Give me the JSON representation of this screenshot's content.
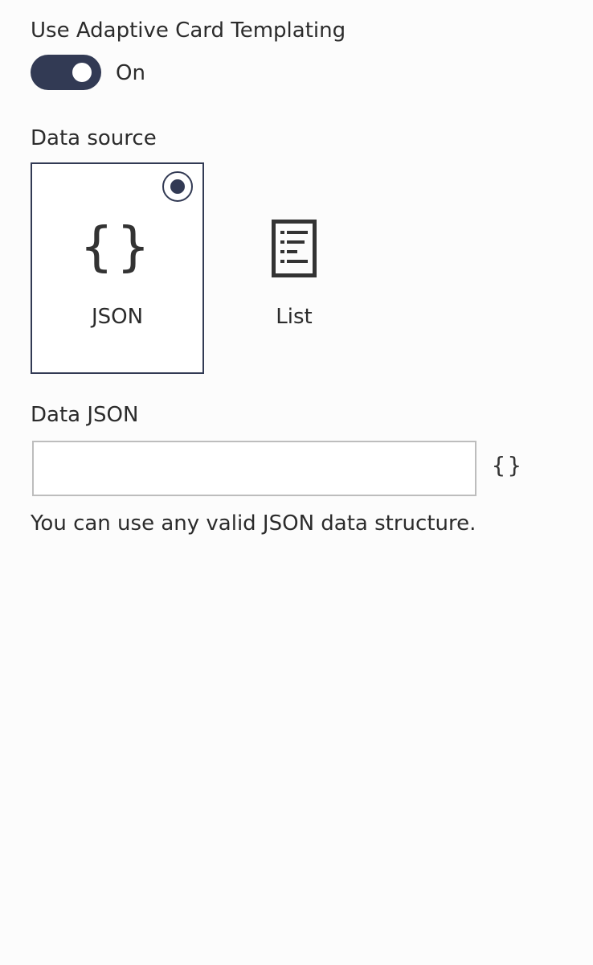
{
  "templating": {
    "label": "Use Adaptive Card Templating",
    "state_label": "On",
    "enabled": true
  },
  "data_source": {
    "label": "Data source",
    "options": [
      {
        "label": "JSON",
        "icon": "curly-braces-icon",
        "selected": true
      },
      {
        "label": "List",
        "icon": "list-document-icon",
        "selected": false
      }
    ]
  },
  "data_json": {
    "label": "Data JSON",
    "value": "",
    "placeholder": "",
    "button_icon": "curly-braces-icon",
    "button_glyph": "{}",
    "help": "You can use any valid JSON data structure."
  },
  "colors": {
    "accent": "#323a54",
    "background": "#fcfcfc"
  }
}
